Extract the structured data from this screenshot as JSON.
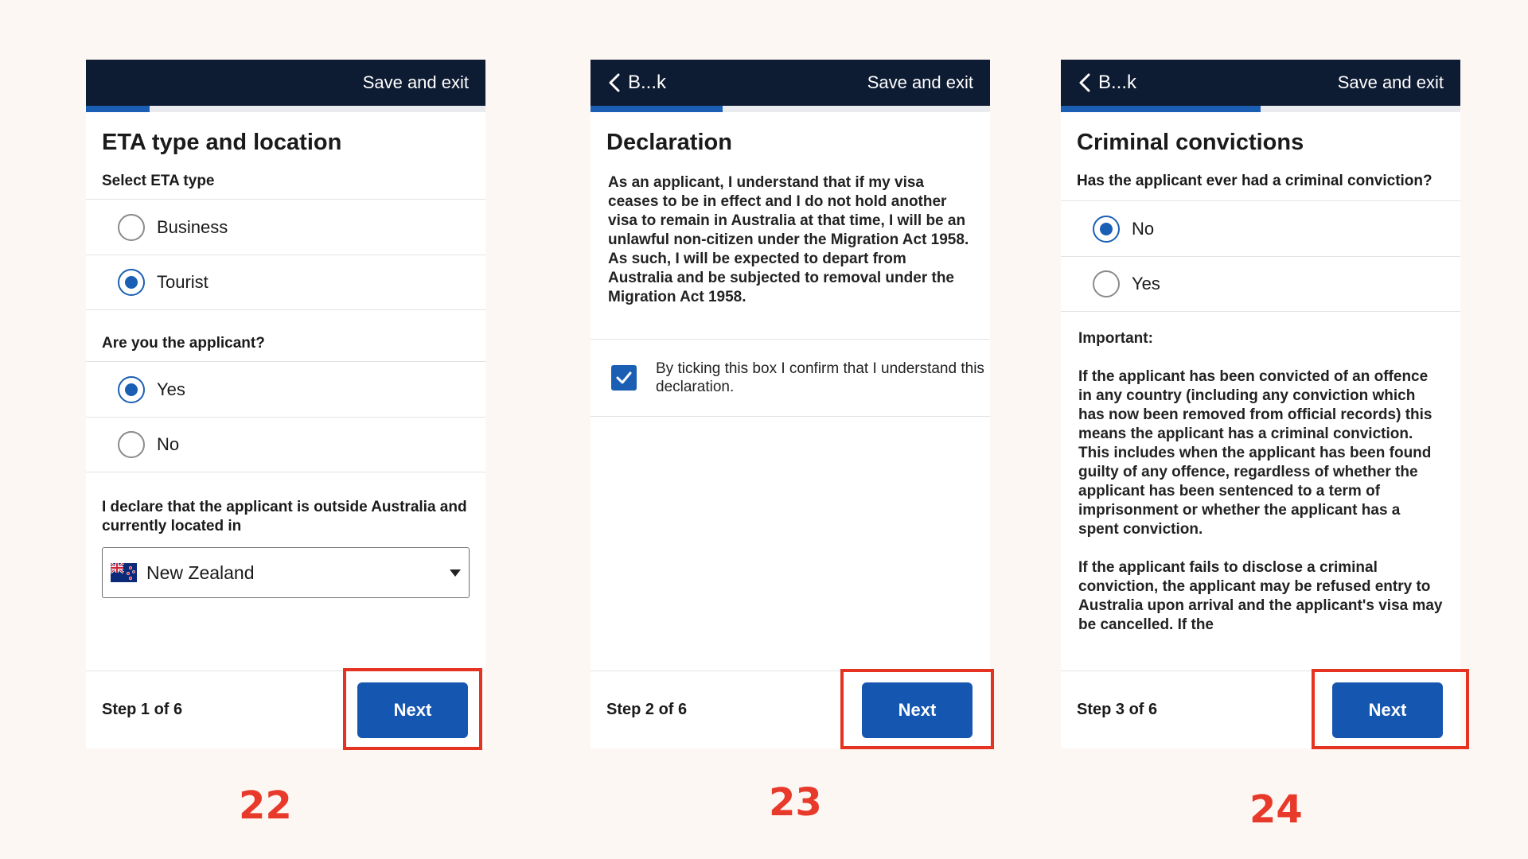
{
  "accent_color": "#1a5fb4",
  "header_color": "#0d1b33",
  "highlight_color": "#e53322",
  "screens": [
    {
      "save_exit": "Save and exit",
      "progress": 0.16,
      "title": "ETA type and location",
      "eta_type_label": "Select ETA type",
      "eta_options": [
        "Business",
        "Tourist"
      ],
      "eta_selected": "Tourist",
      "applicant_label": "Are you the applicant?",
      "applicant_options": [
        "Yes",
        "No"
      ],
      "applicant_selected": "Yes",
      "location_label": "I declare that the applicant is outside Australia and currently located in",
      "location_value": "New Zealand",
      "location_flag_icon": "new-zealand-flag-icon",
      "step": "Step 1 of 6",
      "next": "Next"
    },
    {
      "back": "B...k",
      "save_exit": "Save and exit",
      "progress": 0.33,
      "title": "Declaration",
      "body": "As an applicant, I understand that if my visa ceases to be in effect and I do not hold another visa to remain in Australia at that time, I will be an unlawful non-citizen under the Migration Act 1958. As such, I will be expected to depart from Australia and be subjected to removal under the Migration Act 1958.",
      "checkbox_label": "By ticking this box I confirm that I understand this declaration.",
      "checkbox_checked": true,
      "step": "Step 2 of 6",
      "next": "Next"
    },
    {
      "back": "B...k",
      "save_exit": "Save and exit",
      "progress": 0.5,
      "title": "Criminal convictions",
      "question": "Has the applicant ever had a criminal conviction?",
      "options": [
        "No",
        "Yes"
      ],
      "selected": "No",
      "important_label": "Important:",
      "paragraph1": "If the applicant has been convicted of an offence in any country (including any conviction which has now been removed from official records) this means the applicant has a criminal conviction. This includes when the applicant has been found guilty of any offence, regardless of whether the applicant has been sentenced to a term of imprisonment or whether the applicant has a spent conviction.",
      "paragraph2": "If the applicant fails to disclose a criminal conviction, the applicant may be refused entry to Australia upon arrival and the applicant's visa may be cancelled. If the",
      "step": "Step 3 of 6",
      "next": "Next"
    }
  ],
  "step_numbers": [
    "22",
    "23",
    "24"
  ]
}
